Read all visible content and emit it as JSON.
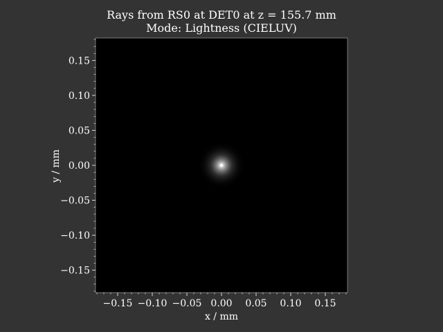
{
  "chart_data": {
    "type": "heatmap",
    "title": "Rays from RS0 at DET0 at z = 155.7 mm",
    "subtitle": "Mode: Lightness (CIELUV)",
    "xlabel": "x / mm",
    "ylabel": "y / mm",
    "xlim": [
      -0.182,
      0.182
    ],
    "ylim": [
      -0.182,
      0.182
    ],
    "xticks": [
      -0.15,
      -0.1,
      -0.05,
      0.0,
      0.05,
      0.1,
      0.15
    ],
    "xtick_labels": [
      "−0.15",
      "−0.10",
      "−0.05",
      "0.00",
      "0.05",
      "0.10",
      "0.15"
    ],
    "yticks": [
      0.15,
      0.1,
      0.05,
      0.0,
      -0.05,
      -0.1,
      -0.15
    ],
    "ytick_labels": [
      "0.15",
      "0.10",
      "0.05",
      "0.00",
      "−0.05",
      "−0.10",
      "−0.15"
    ],
    "grid": false,
    "colormap": "grayscale",
    "spot": {
      "center": [
        0.0,
        0.0
      ],
      "radius": 0.035
    },
    "colors": {
      "background": "#333333",
      "plot_area": "#000000",
      "text": "#ffffff"
    }
  }
}
